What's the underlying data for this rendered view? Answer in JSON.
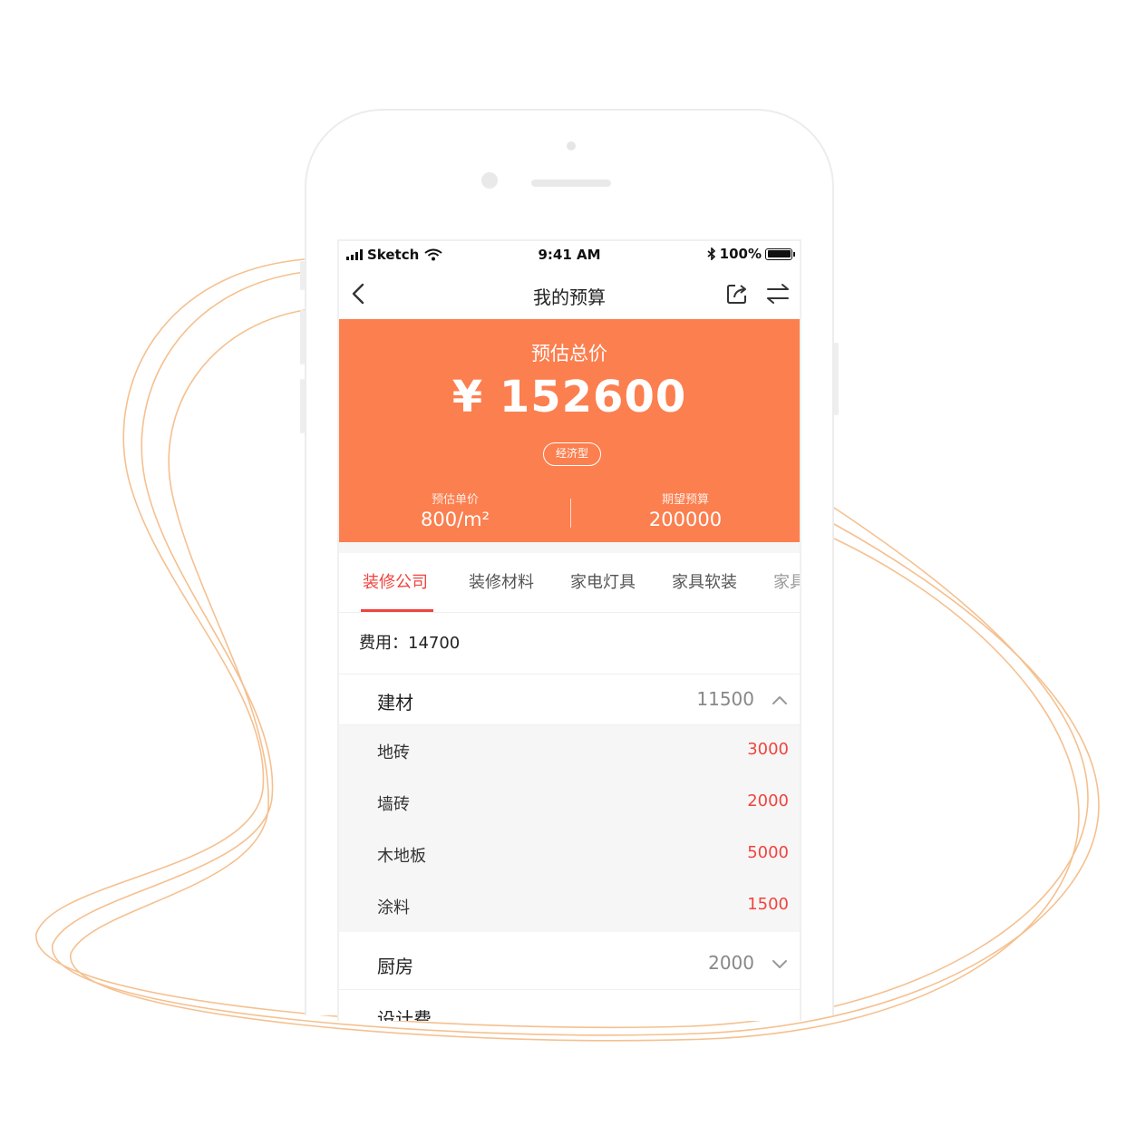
{
  "status_bar": {
    "carrier": "Sketch",
    "time": "9:41 AM",
    "battery": "100%"
  },
  "nav": {
    "title": "我的预算"
  },
  "summary": {
    "label": "预估总价",
    "total": "¥ 152600",
    "badge": "经济型",
    "unit_price_label": "预估单价",
    "unit_price_value": "800/m²",
    "expected_label": "期望预算",
    "expected_value": "200000"
  },
  "tabs": [
    {
      "label": "装修公司"
    },
    {
      "label": "装修材料"
    },
    {
      "label": "家电灯具"
    },
    {
      "label": "家具软装"
    },
    {
      "label": "家具"
    }
  ],
  "fee": "费用：14700",
  "categories": [
    {
      "name": "建材",
      "value": "11500",
      "expanded": true,
      "items": [
        {
          "name": "地砖",
          "value": "3000"
        },
        {
          "name": "墙砖",
          "value": "2000"
        },
        {
          "name": "木地板",
          "value": "5000"
        },
        {
          "name": "涂料",
          "value": "1500"
        }
      ]
    },
    {
      "name": "厨房",
      "value": "2000",
      "expanded": false
    },
    {
      "name": "设计费"
    }
  ],
  "colors": {
    "accent": "#fc7f4f",
    "highlight": "#f0443e",
    "curve": "#f5c08f"
  }
}
